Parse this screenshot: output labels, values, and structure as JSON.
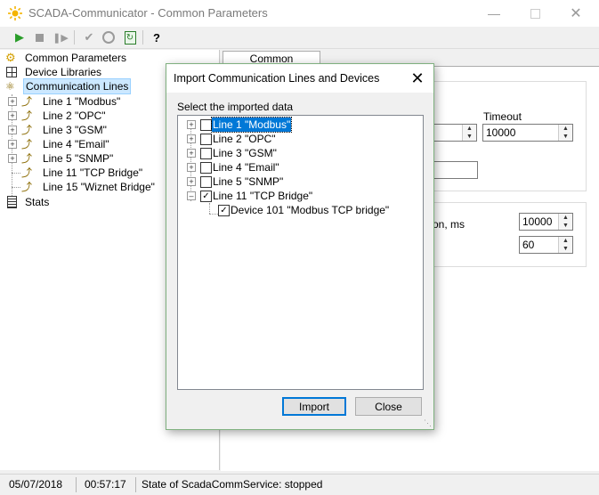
{
  "window": {
    "title": "SCADA-Communicator - Common Parameters"
  },
  "toolbar": {
    "help_label": "?"
  },
  "tree": {
    "items": [
      {
        "label": "Common Parameters",
        "icon": "gear-icon"
      },
      {
        "label": "Device Libraries",
        "icon": "library-icon"
      },
      {
        "label": "Communication Lines",
        "icon": "line-icon"
      },
      {
        "label": "Line 1 \"Modbus\""
      },
      {
        "label": "Line 2 \"OPC\""
      },
      {
        "label": "Line 3 \"GSM\""
      },
      {
        "label": "Line 4 \"Email\""
      },
      {
        "label": "Line 5 \"SNMP\""
      },
      {
        "label": "Line 11 \"TCP Bridge\""
      },
      {
        "label": "Line 15 \"Wiznet Bridge\""
      },
      {
        "label": "Stats",
        "icon": "document-icon"
      }
    ]
  },
  "right": {
    "tab_label": "Common Parameters",
    "timeout_label": "Timeout",
    "timeout_value": "10000",
    "partial_label": "on, ms",
    "value2": "10000",
    "value3": "60"
  },
  "dialog": {
    "title": "Import Communication Lines and Devices",
    "prompt": "Select the imported data",
    "items": [
      {
        "label": "Line 1 \"Modbus\"",
        "checked": false
      },
      {
        "label": "Line 2 \"OPC\"",
        "checked": false
      },
      {
        "label": "Line 3 \"GSM\"",
        "checked": false
      },
      {
        "label": "Line 4 \"Email\"",
        "checked": false
      },
      {
        "label": "Line 5 \"SNMP\"",
        "checked": false
      },
      {
        "label": "Line 11 \"TCP Bridge\"",
        "checked": true
      },
      {
        "label": "Device 101 \"Modbus TCP bridge\"",
        "checked": true
      }
    ],
    "import_label": "Import",
    "close_label": "Close"
  },
  "status": {
    "date": "05/07/2018",
    "time": "00:57:17",
    "message": "State of ScadaCommService: stopped"
  }
}
